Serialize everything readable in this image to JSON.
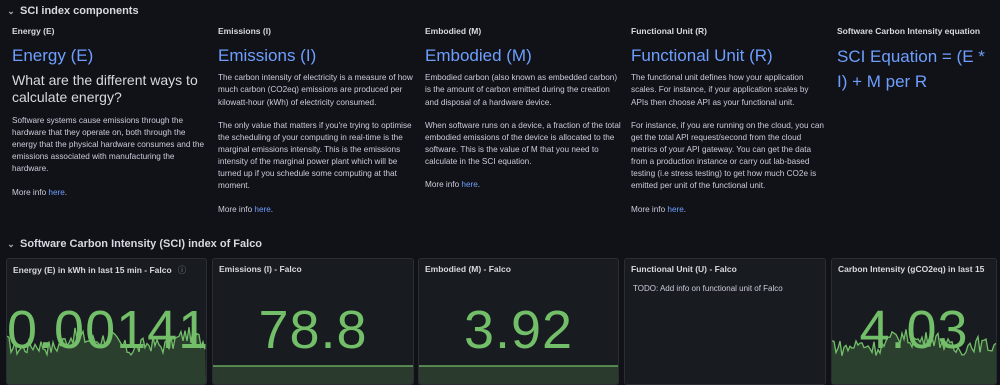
{
  "row1": {
    "title": "SCI index components",
    "chevron": "chevron-down-icon"
  },
  "row2": {
    "title": "Software Carbon Intensity (SCI) index of Falco",
    "chevron": "chevron-down-icon"
  },
  "panels": {
    "energy": {
      "title": "Energy (E)",
      "heading": "Energy (E)",
      "subheading": "What are the different ways to calculate energy?",
      "p1": "Software systems cause emissions through the hardware that they operate on, both through the energy that the physical hardware consumes and the emissions associated with manufacturing the hardware.",
      "more_prefix": "More info ",
      "more_link": "here",
      "more_suffix": "."
    },
    "emissions": {
      "title": "Emissions (I)",
      "heading": "Emissions (I)",
      "p1": "The carbon intensity of electricity is a measure of how much carbon (CO2eq) emissions are produced per kilowatt-hour (kWh) of electricity consumed.",
      "p2": "The only value that matters if you're trying to optimise the scheduling of your computing in real-time is the marginal emissions intensity. This is the emissions intensity of the marginal power plant which will be turned up if you schedule some computing at that moment.",
      "more_prefix": "More info ",
      "more_link": "here",
      "more_suffix": "."
    },
    "embodied": {
      "title": "Embodied (M)",
      "heading": "Embodied (M)",
      "p1": "Embodied carbon (also known as embedded carbon) is the amount of carbon emitted during the creation and disposal of a hardware device.",
      "p2": "When software runs on a device, a fraction of the total embodied emissions of the device is allocated to the software. This is the value of M that you need to calculate in the SCI equation.",
      "more_prefix": "More info ",
      "more_link": "here",
      "more_suffix": "."
    },
    "functional": {
      "title": "Functional Unit (R)",
      "heading": "Functional Unit (R)",
      "p1": "The functional unit defines how your application scales. For instance, if your application scales by APIs then choose API as your functional unit.",
      "p2": "For instance, if you are running on the cloud, you can get the total API request/second from the cloud metrics of your API gateway. You can get the data from a production instance or carry out lab-based testing (i.e stress testing) to get how much CO2e is emitted per unit of the functional unit.",
      "more_prefix": "More info ",
      "more_link": "here",
      "more_suffix": "."
    },
    "equation": {
      "title": "Software Carbon Intensity equation",
      "heading": "SCI Equation = (E * I) + M per R"
    }
  },
  "stats": {
    "energy": {
      "title": "Energy (E) in kWh in last 15 min - Falco",
      "value": "0.00141",
      "icon": "info-icon"
    },
    "emissions": {
      "title": "Emissions (I) - Falco",
      "value": "78.8"
    },
    "embodied": {
      "title": "Embodied (M) - Falco",
      "value": "3.92"
    },
    "functional": {
      "title": "Functional Unit (U) - Falco",
      "todo": "TODO: Add info on functional unit of Falco"
    },
    "intensity": {
      "title": "Carbon Intensity (gCO2eq) in last 15",
      "value": "4.03"
    }
  },
  "colors": {
    "stat_value": "#73bf69",
    "link": "#6e9fff",
    "background": "#111217",
    "panel": "#181b1f"
  }
}
